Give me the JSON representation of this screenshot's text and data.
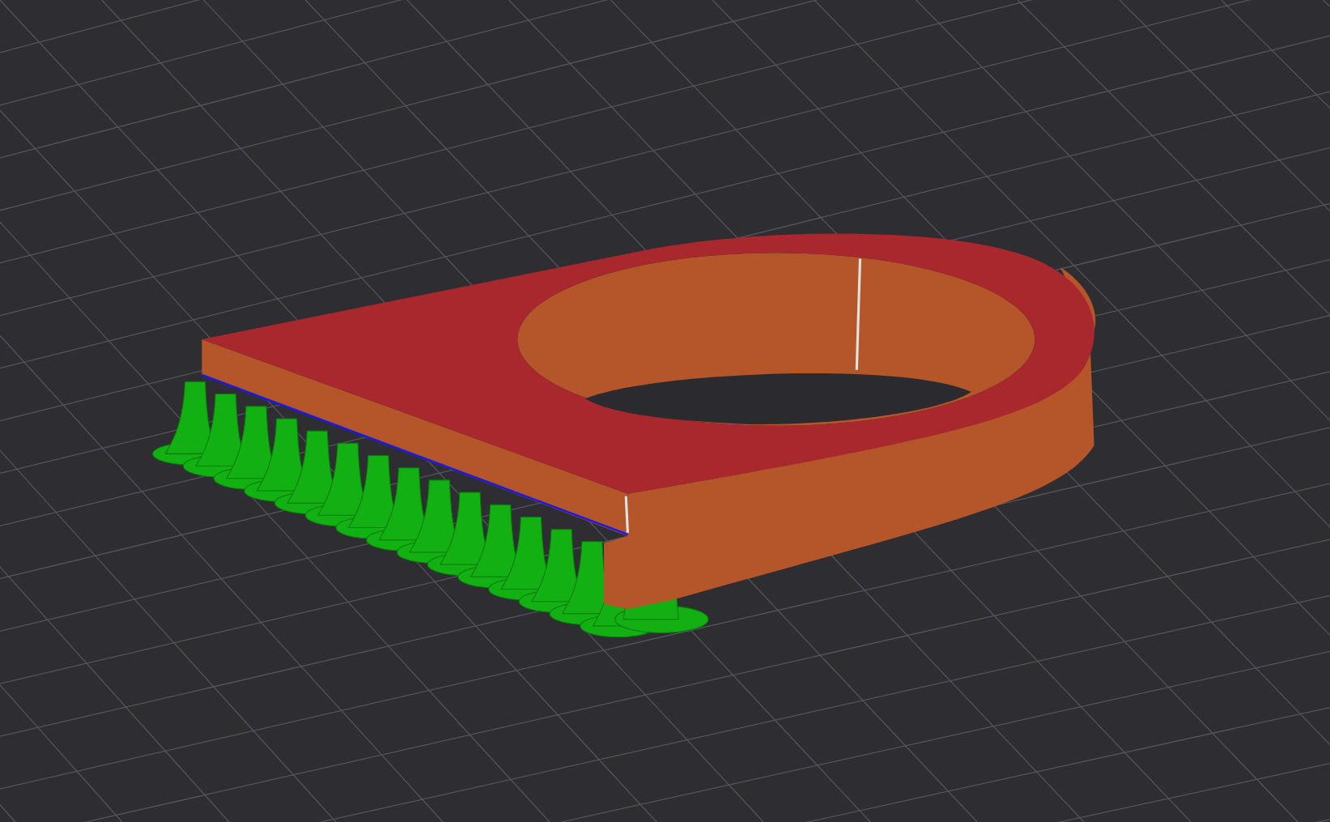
{
  "viewport": {
    "toolpaths": [
      {
        "kind": "perimeter",
        "color": "#b4552a"
      },
      {
        "kind": "top",
        "color": "#a8282e"
      },
      {
        "kind": "support",
        "color": "#12b012"
      },
      {
        "kind": "bridge",
        "color": "#1a1ae6"
      },
      {
        "kind": "seam",
        "color": "#e2e2e2"
      }
    ]
  }
}
